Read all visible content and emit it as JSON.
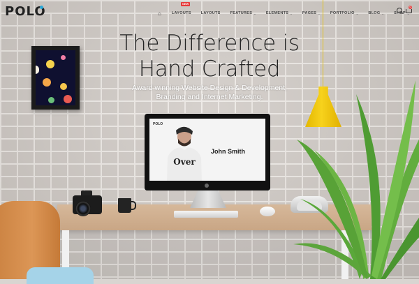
{
  "brand": {
    "logo": "POLO"
  },
  "nav": {
    "items": [
      {
        "label": "LAYOUTS",
        "badge": "NEW",
        "has_dropdown": false
      },
      {
        "label": "LAYOUTS",
        "has_dropdown": false
      },
      {
        "label": "FEATURES",
        "has_dropdown": true
      },
      {
        "label": "ELEMENTS",
        "has_dropdown": true
      },
      {
        "label": "PAGES",
        "has_dropdown": true
      },
      {
        "label": "PORTFOLIO",
        "has_dropdown": true
      },
      {
        "label": "BLOG",
        "has_dropdown": true
      },
      {
        "label": "SHOP",
        "has_dropdown": true
      }
    ],
    "home_icon": "home-icon",
    "search_icon": "search-icon",
    "cart_icon": "cart-icon",
    "cart_count": "0"
  },
  "hero": {
    "title_line1": "The Difference is",
    "title_line2": "Hand Crafted",
    "subtitle_line1": "Award winning Website Design & Development,",
    "subtitle_line2": "Branding and Internet Marketing."
  },
  "monitor_screen": {
    "logo": "POLO",
    "name": "John Smith",
    "shirt_text": "Over"
  },
  "colors": {
    "accent": "#2aa8d8",
    "lamp": "#f2c917",
    "badge": "#e63838",
    "desk": "#d4b494",
    "chair": "#d58f4f"
  }
}
